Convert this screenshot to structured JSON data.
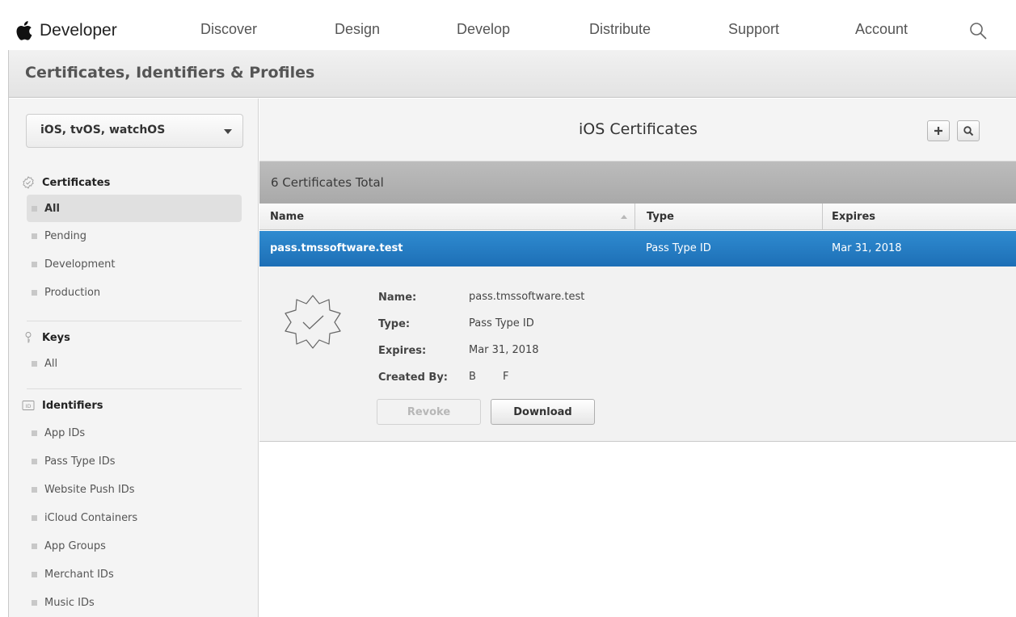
{
  "topnav": {
    "brand": "Developer",
    "links": [
      "Discover",
      "Design",
      "Develop",
      "Distribute",
      "Support",
      "Account"
    ]
  },
  "header": {
    "title": "Certificates, Identifiers & Profiles"
  },
  "sidebar": {
    "platform_select": "iOS, tvOS, watchOS",
    "sections": [
      {
        "title": "Certificates",
        "icon": "certificate-icon",
        "items": [
          "All",
          "Pending",
          "Development",
          "Production"
        ],
        "active_index": 0
      },
      {
        "title": "Keys",
        "icon": "key-icon",
        "items": [
          "All"
        ]
      },
      {
        "title": "Identifiers",
        "icon": "id-icon",
        "items": [
          "App IDs",
          "Pass Type IDs",
          "Website Push IDs",
          "iCloud Containers",
          "App Groups",
          "Merchant IDs",
          "Music IDs"
        ]
      }
    ]
  },
  "content": {
    "title": "iOS Certificates",
    "total": "6 Certificates Total",
    "columns": {
      "name": "Name",
      "type": "Type",
      "expires": "Expires"
    },
    "selected_row": {
      "name": "pass.tmssoftware.test",
      "type": "Pass Type ID",
      "expires": "Mar 31, 2018"
    },
    "detail": {
      "name_label": "Name:",
      "name_value": "pass.tmssoftware.test",
      "type_label": "Type:",
      "type_value": "Pass Type ID",
      "expires_label": "Expires:",
      "expires_value": "Mar 31, 2018",
      "created_label": "Created By:",
      "created_value": "B        F",
      "revoke": "Revoke",
      "download": "Download"
    }
  },
  "colors": {
    "selection": "#1d6fb6",
    "sidebar_bg": "#f4f4f4",
    "total_bar": "#b3b3b3"
  }
}
